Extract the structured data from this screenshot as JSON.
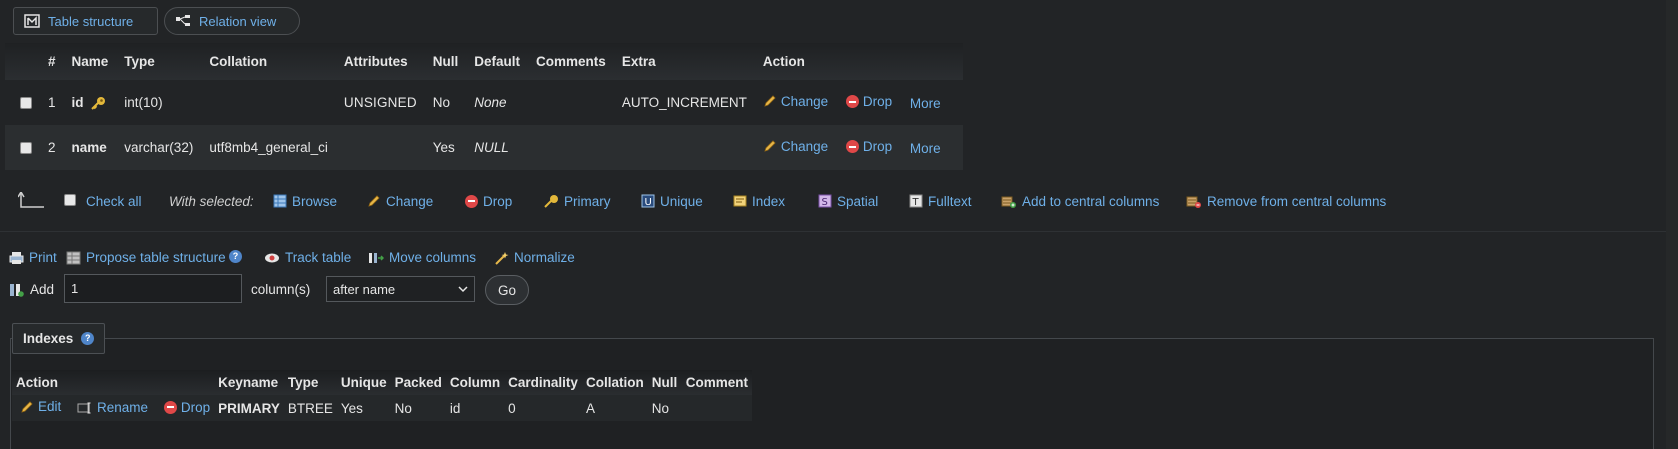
{
  "tabs": {
    "table_structure": "Table structure",
    "relation_view": "Relation view"
  },
  "columns_table": {
    "headers": [
      "#",
      "Name",
      "Type",
      "Collation",
      "Attributes",
      "Null",
      "Default",
      "Comments",
      "Extra",
      "Action"
    ],
    "rows": [
      {
        "num": "1",
        "name": "id",
        "type": "int(10)",
        "collation": "",
        "attributes": "UNSIGNED",
        "null": "No",
        "default": "None",
        "comments": "",
        "extra": "AUTO_INCREMENT"
      },
      {
        "num": "2",
        "name": "name",
        "type": "varchar(32)",
        "collation": "utf8mb4_general_ci",
        "attributes": "",
        "null": "Yes",
        "default": "NULL",
        "comments": "",
        "extra": ""
      }
    ],
    "actions": {
      "change": "Change",
      "drop": "Drop",
      "more": "More"
    }
  },
  "with_selected": {
    "check_all": "Check all",
    "label": "With selected:",
    "browse": "Browse",
    "change": "Change",
    "drop": "Drop",
    "primary": "Primary",
    "unique": "Unique",
    "index": "Index",
    "spatial": "Spatial",
    "fulltext": "Fulltext",
    "add_central": "Add to central columns",
    "remove_central": "Remove from central columns"
  },
  "tools": {
    "print": "Print",
    "propose": "Propose table structure",
    "track": "Track table",
    "move": "Move columns",
    "normalize": "Normalize"
  },
  "add_columns": {
    "label": "Add",
    "count": "1",
    "unit": "column(s)",
    "position": "after name",
    "go": "Go"
  },
  "indexes": {
    "legend": "Indexes",
    "headers": [
      "Action",
      "Keyname",
      "Type",
      "Unique",
      "Packed",
      "Column",
      "Cardinality",
      "Collation",
      "Null",
      "Comment"
    ],
    "row": {
      "edit": "Edit",
      "rename": "Rename",
      "drop": "Drop",
      "keyname": "PRIMARY",
      "type": "BTREE",
      "unique": "Yes",
      "packed": "No",
      "column": "id",
      "cardinality": "0",
      "collation": "A",
      "null": "No",
      "comment": ""
    }
  },
  "colors": {
    "background": "#222426",
    "link": "#6fb0e8",
    "drop_icon": "#e04848"
  }
}
